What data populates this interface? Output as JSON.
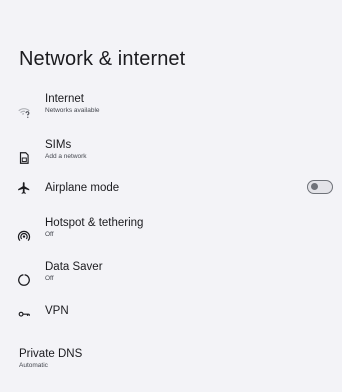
{
  "page": {
    "title": "Network & internet"
  },
  "items": [
    {
      "label": "Internet",
      "summary": "Networks available",
      "icon": "wifi-question-icon"
    },
    {
      "label": "SIMs",
      "summary": "Add a network",
      "icon": "sim-card-icon"
    },
    {
      "label": "Airplane mode",
      "summary": "",
      "icon": "airplane-icon",
      "toggle": false
    },
    {
      "label": "Hotspot & tethering",
      "summary": "Off",
      "icon": "hotspot-icon"
    },
    {
      "label": "Data Saver",
      "summary": "Off",
      "icon": "data-saver-icon"
    },
    {
      "label": "VPN",
      "summary": "",
      "icon": "vpn-key-icon"
    },
    {
      "label": "Private DNS",
      "summary": "Automatic",
      "icon": ""
    }
  ],
  "colors": {
    "background": "#f3f3f7",
    "text_primary": "#1b1b1f",
    "text_secondary": "#44474f",
    "toggle_outline": "#6f7279"
  }
}
